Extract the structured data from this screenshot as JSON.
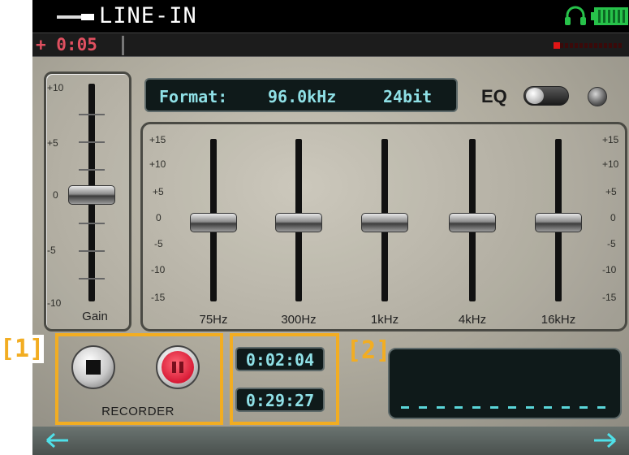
{
  "titlebar": {
    "title": "LINE-IN",
    "icons": [
      "line-in-cable-icon",
      "headphones-icon",
      "battery-icon"
    ]
  },
  "timebar": {
    "elapsed": "+ 0:05"
  },
  "format": {
    "label": "Format:",
    "rate": "96.0kHz",
    "bits": "24bit"
  },
  "eq": {
    "label": "EQ",
    "enabled": false,
    "scale": [
      "+15",
      "+10",
      "+5",
      "0",
      "-5",
      "-10",
      "-15"
    ],
    "bands": [
      {
        "label": "75Hz",
        "value": 0
      },
      {
        "label": "300Hz",
        "value": 0
      },
      {
        "label": "1kHz",
        "value": 0
      },
      {
        "label": "4kHz",
        "value": 0
      },
      {
        "label": "16kHz",
        "value": 0
      }
    ]
  },
  "gain": {
    "label": "Gain",
    "scale": [
      "+10",
      "+5",
      "0",
      "-5",
      "-10"
    ],
    "value": 0
  },
  "recorder": {
    "label": "RECORDER",
    "time_1": "0:02:04",
    "time_2": "0:29:27"
  },
  "annotations": {
    "tag_1": "[1]",
    "tag_2": "[2]"
  },
  "colors": {
    "accent": "#f2ad22",
    "display_text": "#8fe0e6",
    "elapsed_text": "#e05060",
    "pause_red": "#d81a35",
    "battery_green": "#27c24a"
  }
}
